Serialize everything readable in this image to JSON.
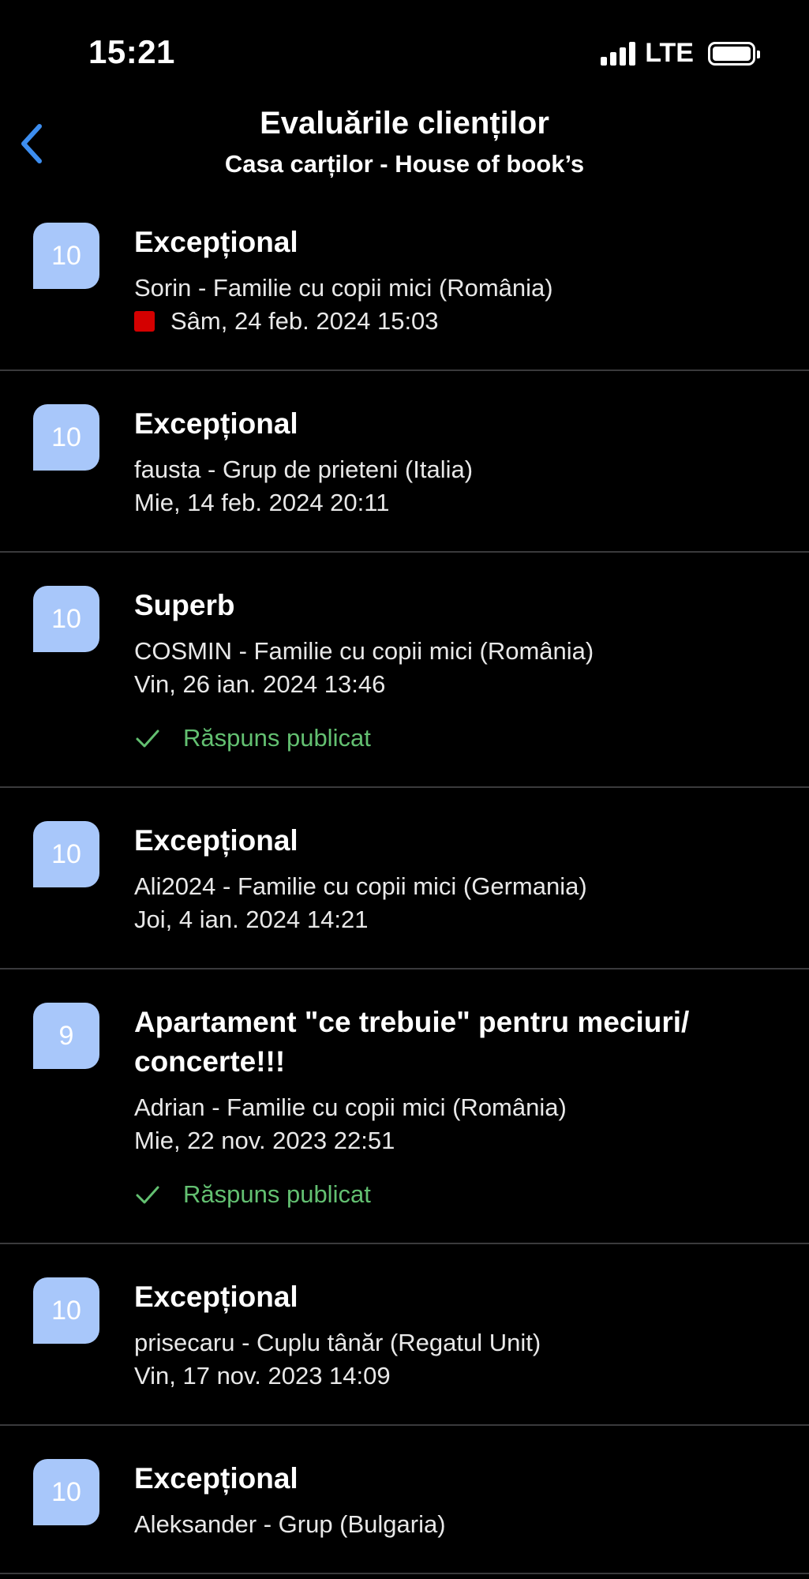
{
  "status_bar": {
    "time": "15:21",
    "network": "LTE",
    "icons": [
      "signal-icon",
      "battery-icon"
    ]
  },
  "header": {
    "title": "Evaluările clienților",
    "subtitle": "Casa carților - House of book’s",
    "back_icon": "chevron-left-icon"
  },
  "colors": {
    "background": "#000000",
    "badge": "#a8c7fa",
    "accent_blue": "#3d8ef0",
    "reply_green": "#63c071",
    "new_indicator": "#d40000",
    "divider": "#3a3a3c"
  },
  "reviews": [
    {
      "score": "10",
      "title": "Excepțional",
      "author": "Sorin - Familie cu copii mici (România)",
      "date": "Sâm, 24 feb. 2024 15:03",
      "is_new": true,
      "reply": ""
    },
    {
      "score": "10",
      "title": "Excepțional",
      "author": "fausta - Grup de prieteni (Italia)",
      "date": "Mie, 14 feb. 2024 20:11",
      "is_new": false,
      "reply": ""
    },
    {
      "score": "10",
      "title": "Superb",
      "author": "COSMIN - Familie cu copii mici (România)",
      "date": "Vin, 26 ian. 2024 13:46",
      "is_new": false,
      "reply": "Răspuns publicat"
    },
    {
      "score": "10",
      "title": "Excepțional",
      "author": "Ali2024 - Familie cu copii mici (Germania)",
      "date": "Joi, 4 ian. 2024 14:21",
      "is_new": false,
      "reply": ""
    },
    {
      "score": "9",
      "title": "Apartament \"ce trebuie\" pentru meciuri/ concerte!!!",
      "author": "Adrian - Familie cu copii mici (România)",
      "date": "Mie, 22 nov. 2023 22:51",
      "is_new": false,
      "reply": "Răspuns publicat"
    },
    {
      "score": "10",
      "title": "Excepțional",
      "author": "prisecaru - Cuplu tânăr (Regatul Unit)",
      "date": "Vin, 17 nov. 2023 14:09",
      "is_new": false,
      "reply": ""
    },
    {
      "score": "10",
      "title": "Excepțional",
      "author": "Aleksander - Grup (Bulgaria)",
      "date": "",
      "is_new": false,
      "reply": ""
    }
  ]
}
